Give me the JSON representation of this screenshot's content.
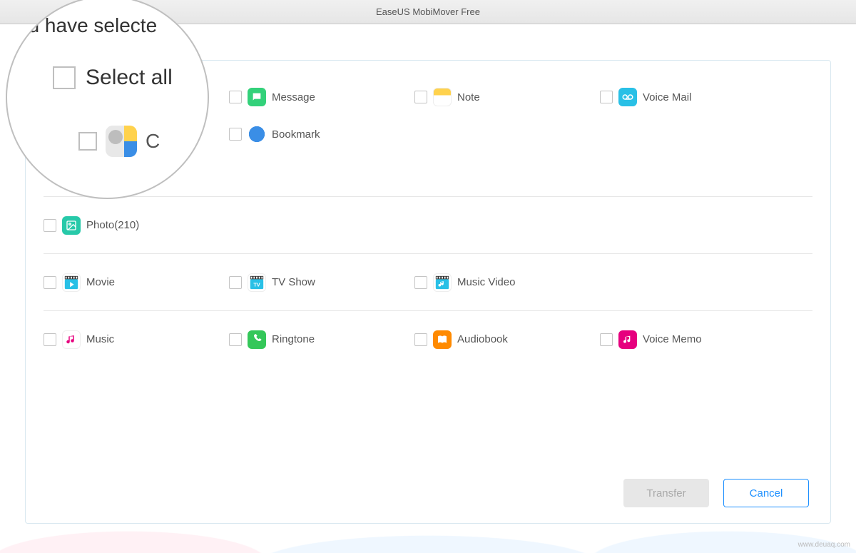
{
  "window": {
    "title": "EaseUS MobiMover Free"
  },
  "magnifier": {
    "header_partial": "ou have selecte",
    "select_all_label": "Select all",
    "contact_label_partial": "C"
  },
  "categories": {
    "message": {
      "label": "Message"
    },
    "note": {
      "label": "Note"
    },
    "voicemail": {
      "label": "Voice Mail"
    },
    "bookmark": {
      "label": "Bookmark"
    },
    "photo": {
      "label": "Photo(210)"
    },
    "movie": {
      "label": "Movie"
    },
    "tvshow": {
      "label": "TV Show"
    },
    "musicvid": {
      "label": "Music Video"
    },
    "music": {
      "label": "Music"
    },
    "ringtone": {
      "label": "Ringtone"
    },
    "audiobook": {
      "label": "Audiobook"
    },
    "voicememo": {
      "label": "Voice Memo"
    }
  },
  "buttons": {
    "transfer": "Transfer",
    "cancel": "Cancel"
  },
  "watermark": "www.deuaq.com"
}
